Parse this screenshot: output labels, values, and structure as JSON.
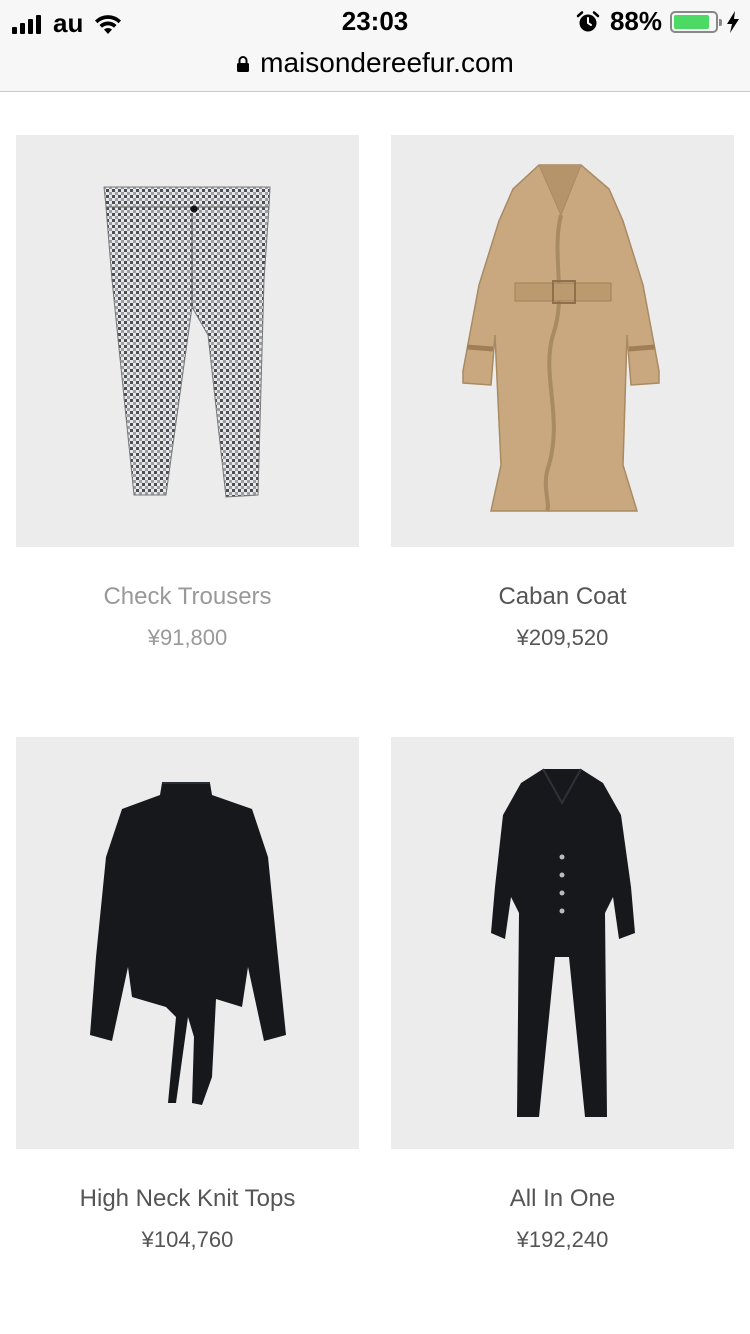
{
  "status_bar": {
    "carrier": "au",
    "time": "23:03",
    "battery_percent": "88%",
    "battery_level": 0.88,
    "icons": [
      "signal-icon",
      "wifi-icon",
      "alarm-icon",
      "battery-icon",
      "charging-bolt-icon"
    ]
  },
  "browser": {
    "url": "maisondereefur.com",
    "lock_icon": "lock-icon"
  },
  "products": [
    {
      "name": "Check Trousers",
      "price": "¥91,800",
      "image": "check-trousers-image",
      "color": "#8a8d92"
    },
    {
      "name": "Caban Coat",
      "price": "¥209,520",
      "image": "caban-coat-image",
      "color": "#c9a87f"
    },
    {
      "name": "High Neck Knit Tops",
      "price": "¥104,760",
      "image": "high-neck-knit-image",
      "color": "#16181c"
    },
    {
      "name": "All In One",
      "price": "¥192,240",
      "image": "all-in-one-image",
      "color": "#16181c"
    }
  ],
  "colors": {
    "image_background": "#ececec",
    "battery_green": "#4cd964",
    "text": "#555555",
    "text_faded": "#999999"
  }
}
